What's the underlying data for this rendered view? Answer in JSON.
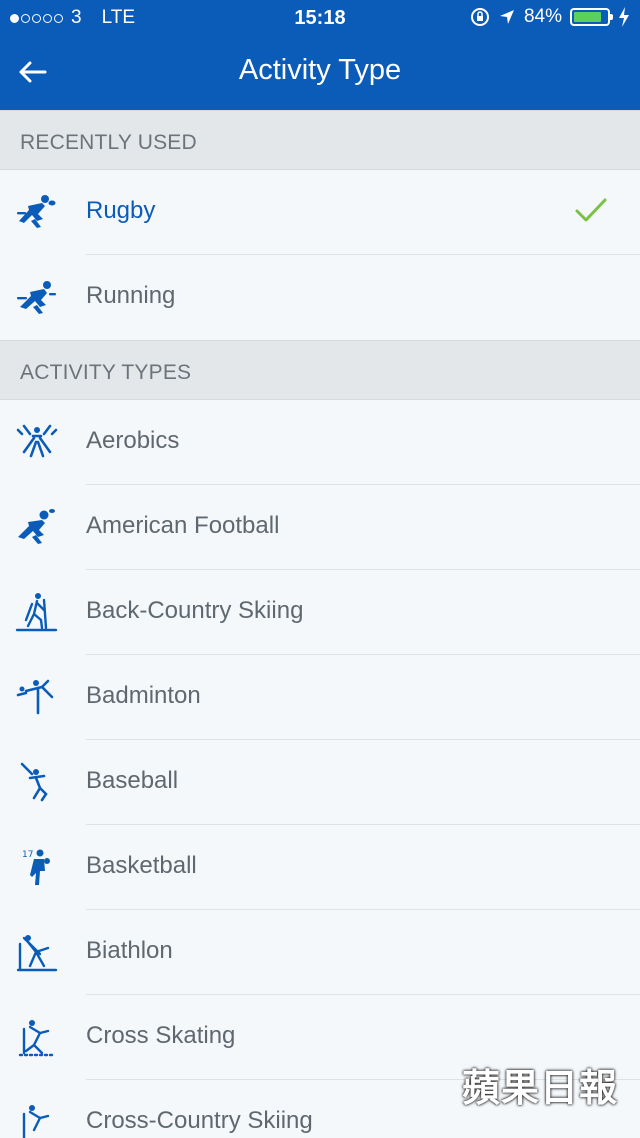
{
  "status_bar": {
    "carrier": "3",
    "network": "LTE",
    "time": "15:18",
    "battery": "84%",
    "battery_level": 0.84
  },
  "nav": {
    "title": "Activity Type",
    "back_icon": "arrow-left-icon"
  },
  "sections": {
    "recent": {
      "header": "RECENTLY USED",
      "items": [
        {
          "label": "Rugby",
          "icon": "rugby-icon",
          "selected": true
        },
        {
          "label": "Running",
          "icon": "running-icon",
          "selected": false
        }
      ]
    },
    "types": {
      "header": "ACTIVITY TYPES",
      "items": [
        {
          "label": "Aerobics",
          "icon": "aerobics-icon"
        },
        {
          "label": "American Football",
          "icon": "american-football-icon"
        },
        {
          "label": "Back-Country Skiing",
          "icon": "back-country-skiing-icon"
        },
        {
          "label": "Badminton",
          "icon": "badminton-icon"
        },
        {
          "label": "Baseball",
          "icon": "baseball-icon"
        },
        {
          "label": "Basketball",
          "icon": "basketball-icon"
        },
        {
          "label": "Biathlon",
          "icon": "biathlon-icon"
        },
        {
          "label": "Cross Skating",
          "icon": "cross-skating-icon"
        },
        {
          "label": "Cross-Country Skiing",
          "icon": "cross-country-skiing-icon"
        }
      ]
    }
  },
  "watermark": "蘋果日報",
  "colors": {
    "header_bg": "#0b5cb8",
    "accent": "#0b5cb8",
    "check": "#7cc242",
    "section_bg": "#e4e7ea"
  }
}
